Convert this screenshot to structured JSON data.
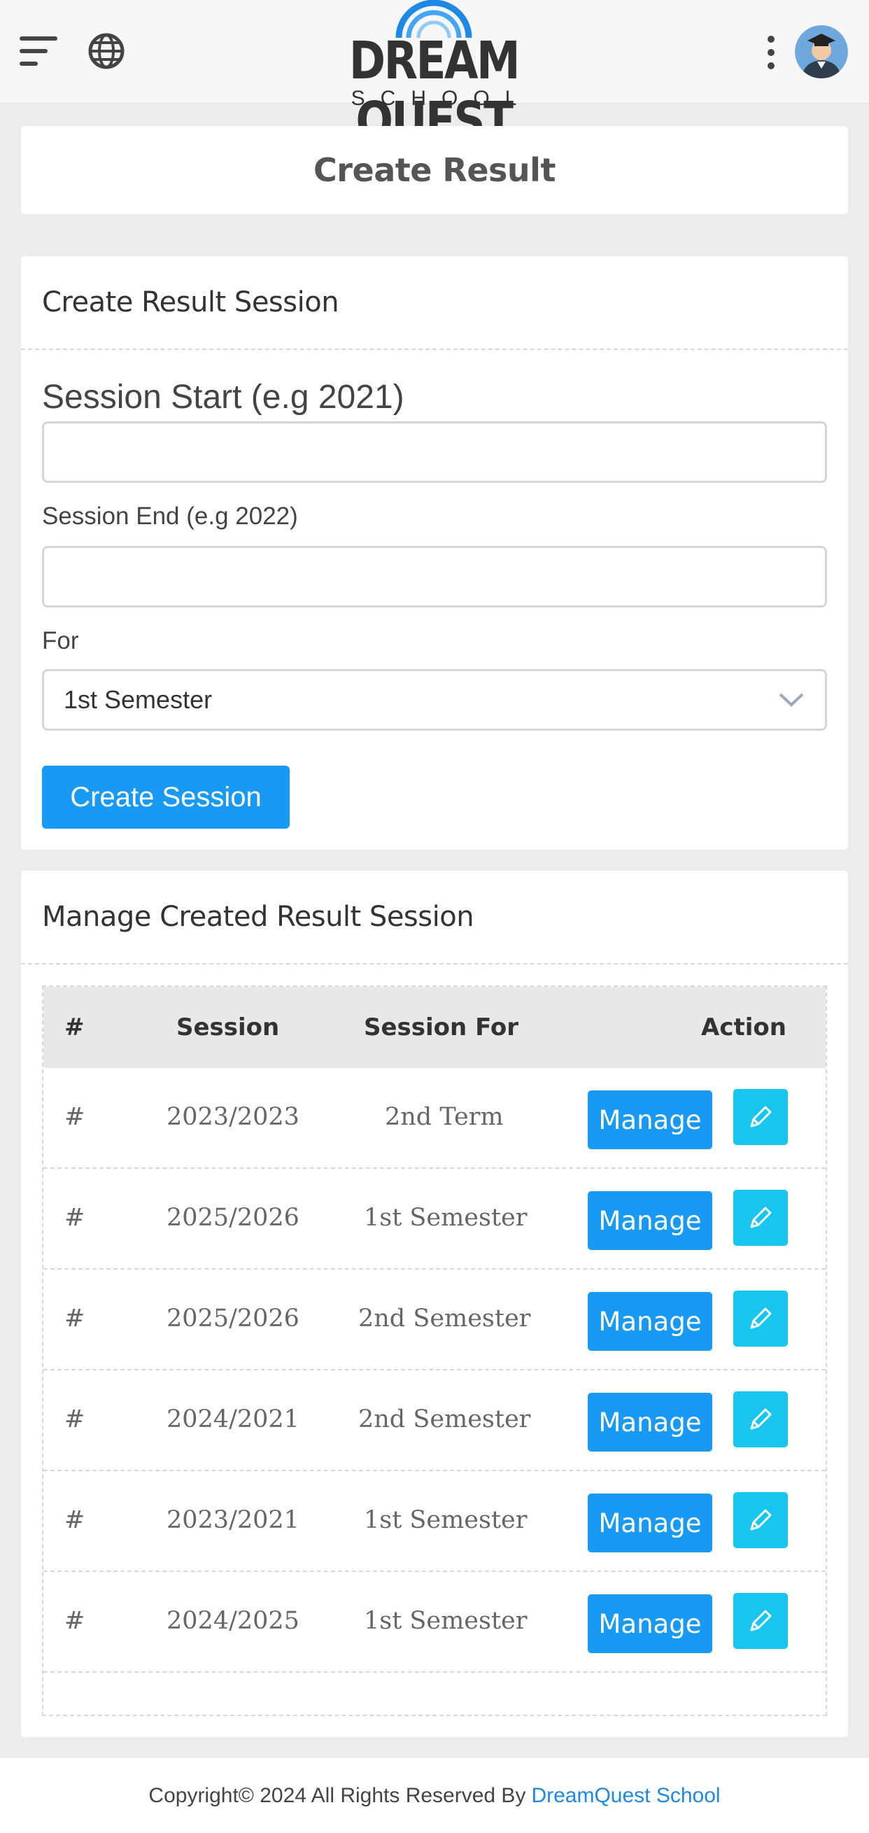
{
  "header": {
    "logo_title": "DREAM QUEST",
    "logo_sub": "SCHOOL",
    "icons": [
      "menu-icon",
      "globe-icon",
      "kebab-icon",
      "avatar-icon"
    ]
  },
  "page_title": "Create Result",
  "form": {
    "heading": "Create Result Session",
    "start_label": "Session Start (e.g 2021)",
    "start_value": "",
    "end_label": "Session End (e.g 2022)",
    "end_value": "",
    "for_label": "For",
    "for_selected": "1st Semester",
    "submit_label": "Create Session"
  },
  "list": {
    "heading": "Manage Created Result Session",
    "columns": [
      "#",
      "Session",
      "Session For",
      "Action"
    ],
    "rows": [
      {
        "num": "#",
        "session": "2023/2023",
        "for": "2nd Term",
        "action": "Manage"
      },
      {
        "num": "#",
        "session": "2025/2026",
        "for": "1st Semester",
        "action": "Manage"
      },
      {
        "num": "#",
        "session": "2025/2026",
        "for": "2nd Semester",
        "action": "Manage"
      },
      {
        "num": "#",
        "session": "2024/2021",
        "for": "2nd Semester",
        "action": "Manage"
      },
      {
        "num": "#",
        "session": "2023/2021",
        "for": "1st Semester",
        "action": "Manage"
      },
      {
        "num": "#",
        "session": "2024/2025",
        "for": "1st Semester",
        "action": "Manage"
      }
    ]
  },
  "footer": {
    "text": "Copyright© 2024 All Rights Reserved By",
    "link": "DreamQuest School"
  },
  "colors": {
    "primary": "#1899f3",
    "edit": "#17c5ee",
    "link": "#1e88e5"
  }
}
